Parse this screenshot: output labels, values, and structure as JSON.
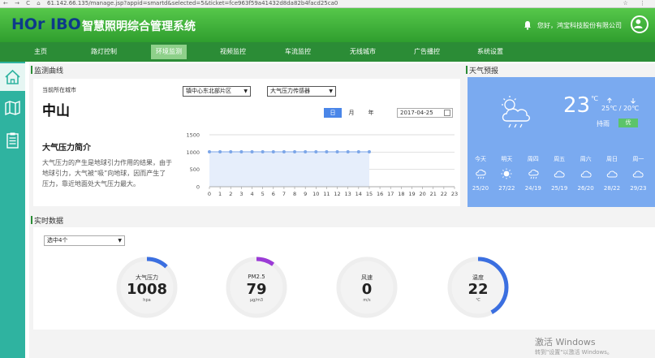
{
  "browser": {
    "url": "61.142.66.135/manage.jsp?appid=smartd&selected=5&ticket=fce963f59a41432d8da82b4facd25ca0"
  },
  "header": {
    "logo": "HOr IBO",
    "title": "智慧照明综合管理系统",
    "greeting": "您好，鸿宝科技股份有限公司"
  },
  "nav": {
    "items": [
      {
        "label": "主页"
      },
      {
        "label": "路灯控制"
      },
      {
        "label": "环境监测"
      },
      {
        "label": "视频监控"
      },
      {
        "label": "车流监控"
      },
      {
        "label": "无线城市"
      },
      {
        "label": "广告播控"
      },
      {
        "label": "系统设置"
      }
    ],
    "active_index": 2
  },
  "monitor": {
    "section_title": "监测曲线",
    "city_caption": "当前所在城市",
    "city": "中山",
    "zone_select": "镇中心东北部片区",
    "sensor_select": "大气压力传感器",
    "period_tabs": [
      "日",
      "月",
      "年"
    ],
    "active_period": "日",
    "date": "2017-04-25",
    "intro_title": "大气压力简介",
    "intro_text": "大气压力的产生是地球引力作用的结果，由于地球引力，大气被“吸”向地球，因而产生了压力，靠近地面处大气压力最大。"
  },
  "chart_data": {
    "type": "area",
    "x": [
      0,
      1,
      2,
      3,
      4,
      5,
      6,
      7,
      8,
      9,
      10,
      11,
      12,
      13,
      14,
      15,
      16,
      17,
      18,
      19,
      20,
      21,
      22,
      23
    ],
    "series": [
      {
        "values": [
          1008,
          1008,
          1008,
          1008,
          1008,
          1008,
          1008,
          1008,
          1008,
          1008,
          1008,
          1008,
          1008,
          1008,
          1008,
          1008
        ]
      }
    ],
    "yticks": [
      0,
      500,
      1000,
      1500
    ],
    "ylim": [
      0,
      1500
    ],
    "xlim": [
      0,
      23
    ],
    "grid": true,
    "colors": {
      "line": "#7ca6e8",
      "fill": "#e6eefb",
      "grid": "#d0d0d0"
    }
  },
  "weather": {
    "section_title": "天气预报",
    "temp": "23",
    "temp_unit": "℃",
    "range": "25℃ / 20℃",
    "aqi_label": "持雨",
    "aqi_badge": "优",
    "days": [
      {
        "label": "今天",
        "icon": "rain-cloud-icon",
        "range": "25/20"
      },
      {
        "label": "明天",
        "icon": "sun-icon",
        "range": "27/22"
      },
      {
        "label": "周四",
        "icon": "rain-cloud-icon",
        "range": "24/19"
      },
      {
        "label": "周五",
        "icon": "cloud-icon",
        "range": "25/19"
      },
      {
        "label": "周六",
        "icon": "cloud-icon",
        "range": "26/20"
      },
      {
        "label": "周日",
        "icon": "cloud-icon",
        "range": "28/22"
      },
      {
        "label": "周一",
        "icon": "cloud-icon",
        "range": "29/23"
      }
    ]
  },
  "realtime": {
    "section_title": "实时数据",
    "select": "选中4个",
    "gauges": [
      {
        "label": "大气压力",
        "value": "1008",
        "unit": "hpa",
        "fraction": 0.12,
        "color": "#3b6fe0"
      },
      {
        "label": "PM2.5",
        "value": "79",
        "unit": "μg/m3",
        "fraction": 0.1,
        "color": "#9b3bd6"
      },
      {
        "label": "风速",
        "value": "0",
        "unit": "m/s",
        "fraction": 0,
        "color": "#3b6fe0"
      },
      {
        "label": "温度",
        "value": "22",
        "unit": "℃",
        "fraction": 0.42,
        "color": "#3b6fe0"
      }
    ]
  },
  "watermark": {
    "line1": "激活 Windows",
    "line2": "转到\"设置\"以激活 Windows。"
  }
}
